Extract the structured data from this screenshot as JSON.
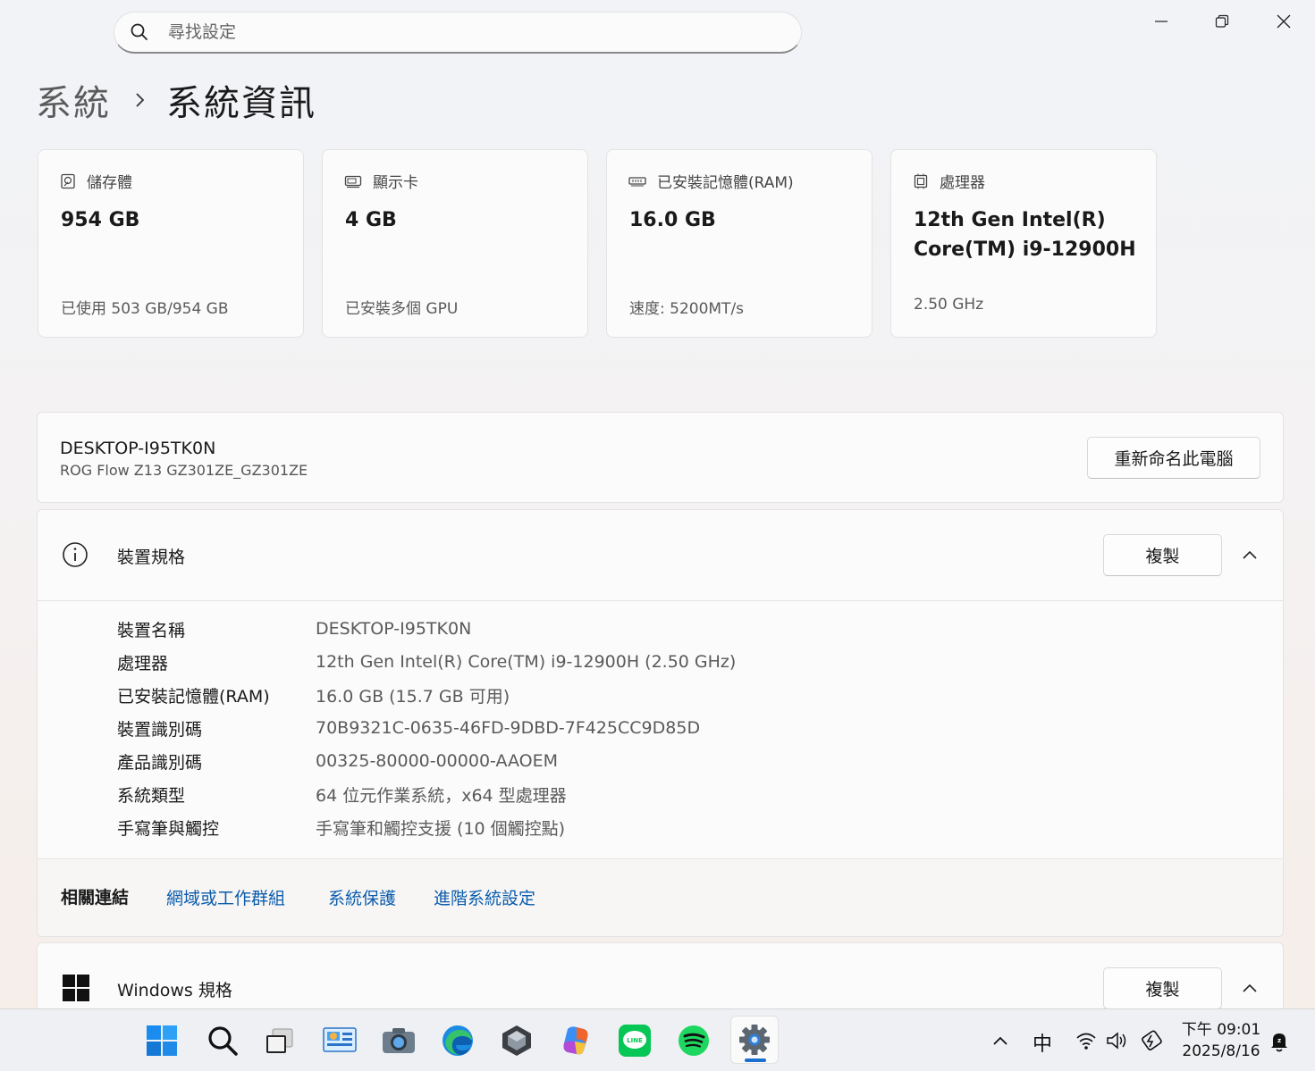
{
  "search": {
    "placeholder": "尋找設定"
  },
  "breadcrumb": {
    "parent": "系統",
    "current": "系統資訊"
  },
  "cards": [
    {
      "label": "儲存體",
      "value": "954 GB",
      "sub": "已使用 503 GB/954 GB",
      "icon": "storage-icon"
    },
    {
      "label": "顯示卡",
      "value": "4 GB",
      "sub": "已安裝多個 GPU",
      "icon": "gpu-icon"
    },
    {
      "label": "已安裝記憶體(RAM)",
      "value": "16.0 GB",
      "sub": "速度: 5200MT/s",
      "icon": "ram-icon"
    },
    {
      "label": "處理器",
      "value": "12th Gen Intel(R) Core(TM) i9-12900H",
      "sub": "2.50 GHz",
      "icon": "cpu-icon"
    }
  ],
  "device": {
    "name": "DESKTOP-I95TK0N",
    "model": "ROG Flow Z13 GZ301ZE_GZ301ZE",
    "rename_button": "重新命名此電腦"
  },
  "device_specs": {
    "title": "裝置規格",
    "copy_button": "複製",
    "rows": [
      {
        "key": "裝置名稱",
        "value": "DESKTOP-I95TK0N"
      },
      {
        "key": "處理器",
        "value": "12th Gen Intel(R) Core(TM) i9-12900H (2.50 GHz)"
      },
      {
        "key": "已安裝記憶體(RAM)",
        "value": "16.0 GB (15.7 GB 可用)"
      },
      {
        "key": "裝置識別碼",
        "value": "70B9321C-0635-46FD-9DBD-7F425CC9D85D"
      },
      {
        "key": "產品識別碼",
        "value": "00325-80000-00000-AAOEM"
      },
      {
        "key": "系統類型",
        "value": "64 位元作業系統，x64 型處理器"
      },
      {
        "key": "手寫筆與觸控",
        "value": "手寫筆和觸控支援 (10 個觸控點)"
      }
    ]
  },
  "related_links": {
    "label": "相關連結",
    "links": [
      "網域或工作群組",
      "系統保護",
      "進階系統設定"
    ],
    "link_color": "#0b5cad"
  },
  "windows_specs": {
    "title": "Windows 規格",
    "copy_button": "複製"
  },
  "taskbar": {
    "ime": "中",
    "time": "下午 09:01",
    "date": "2025/8/16"
  }
}
